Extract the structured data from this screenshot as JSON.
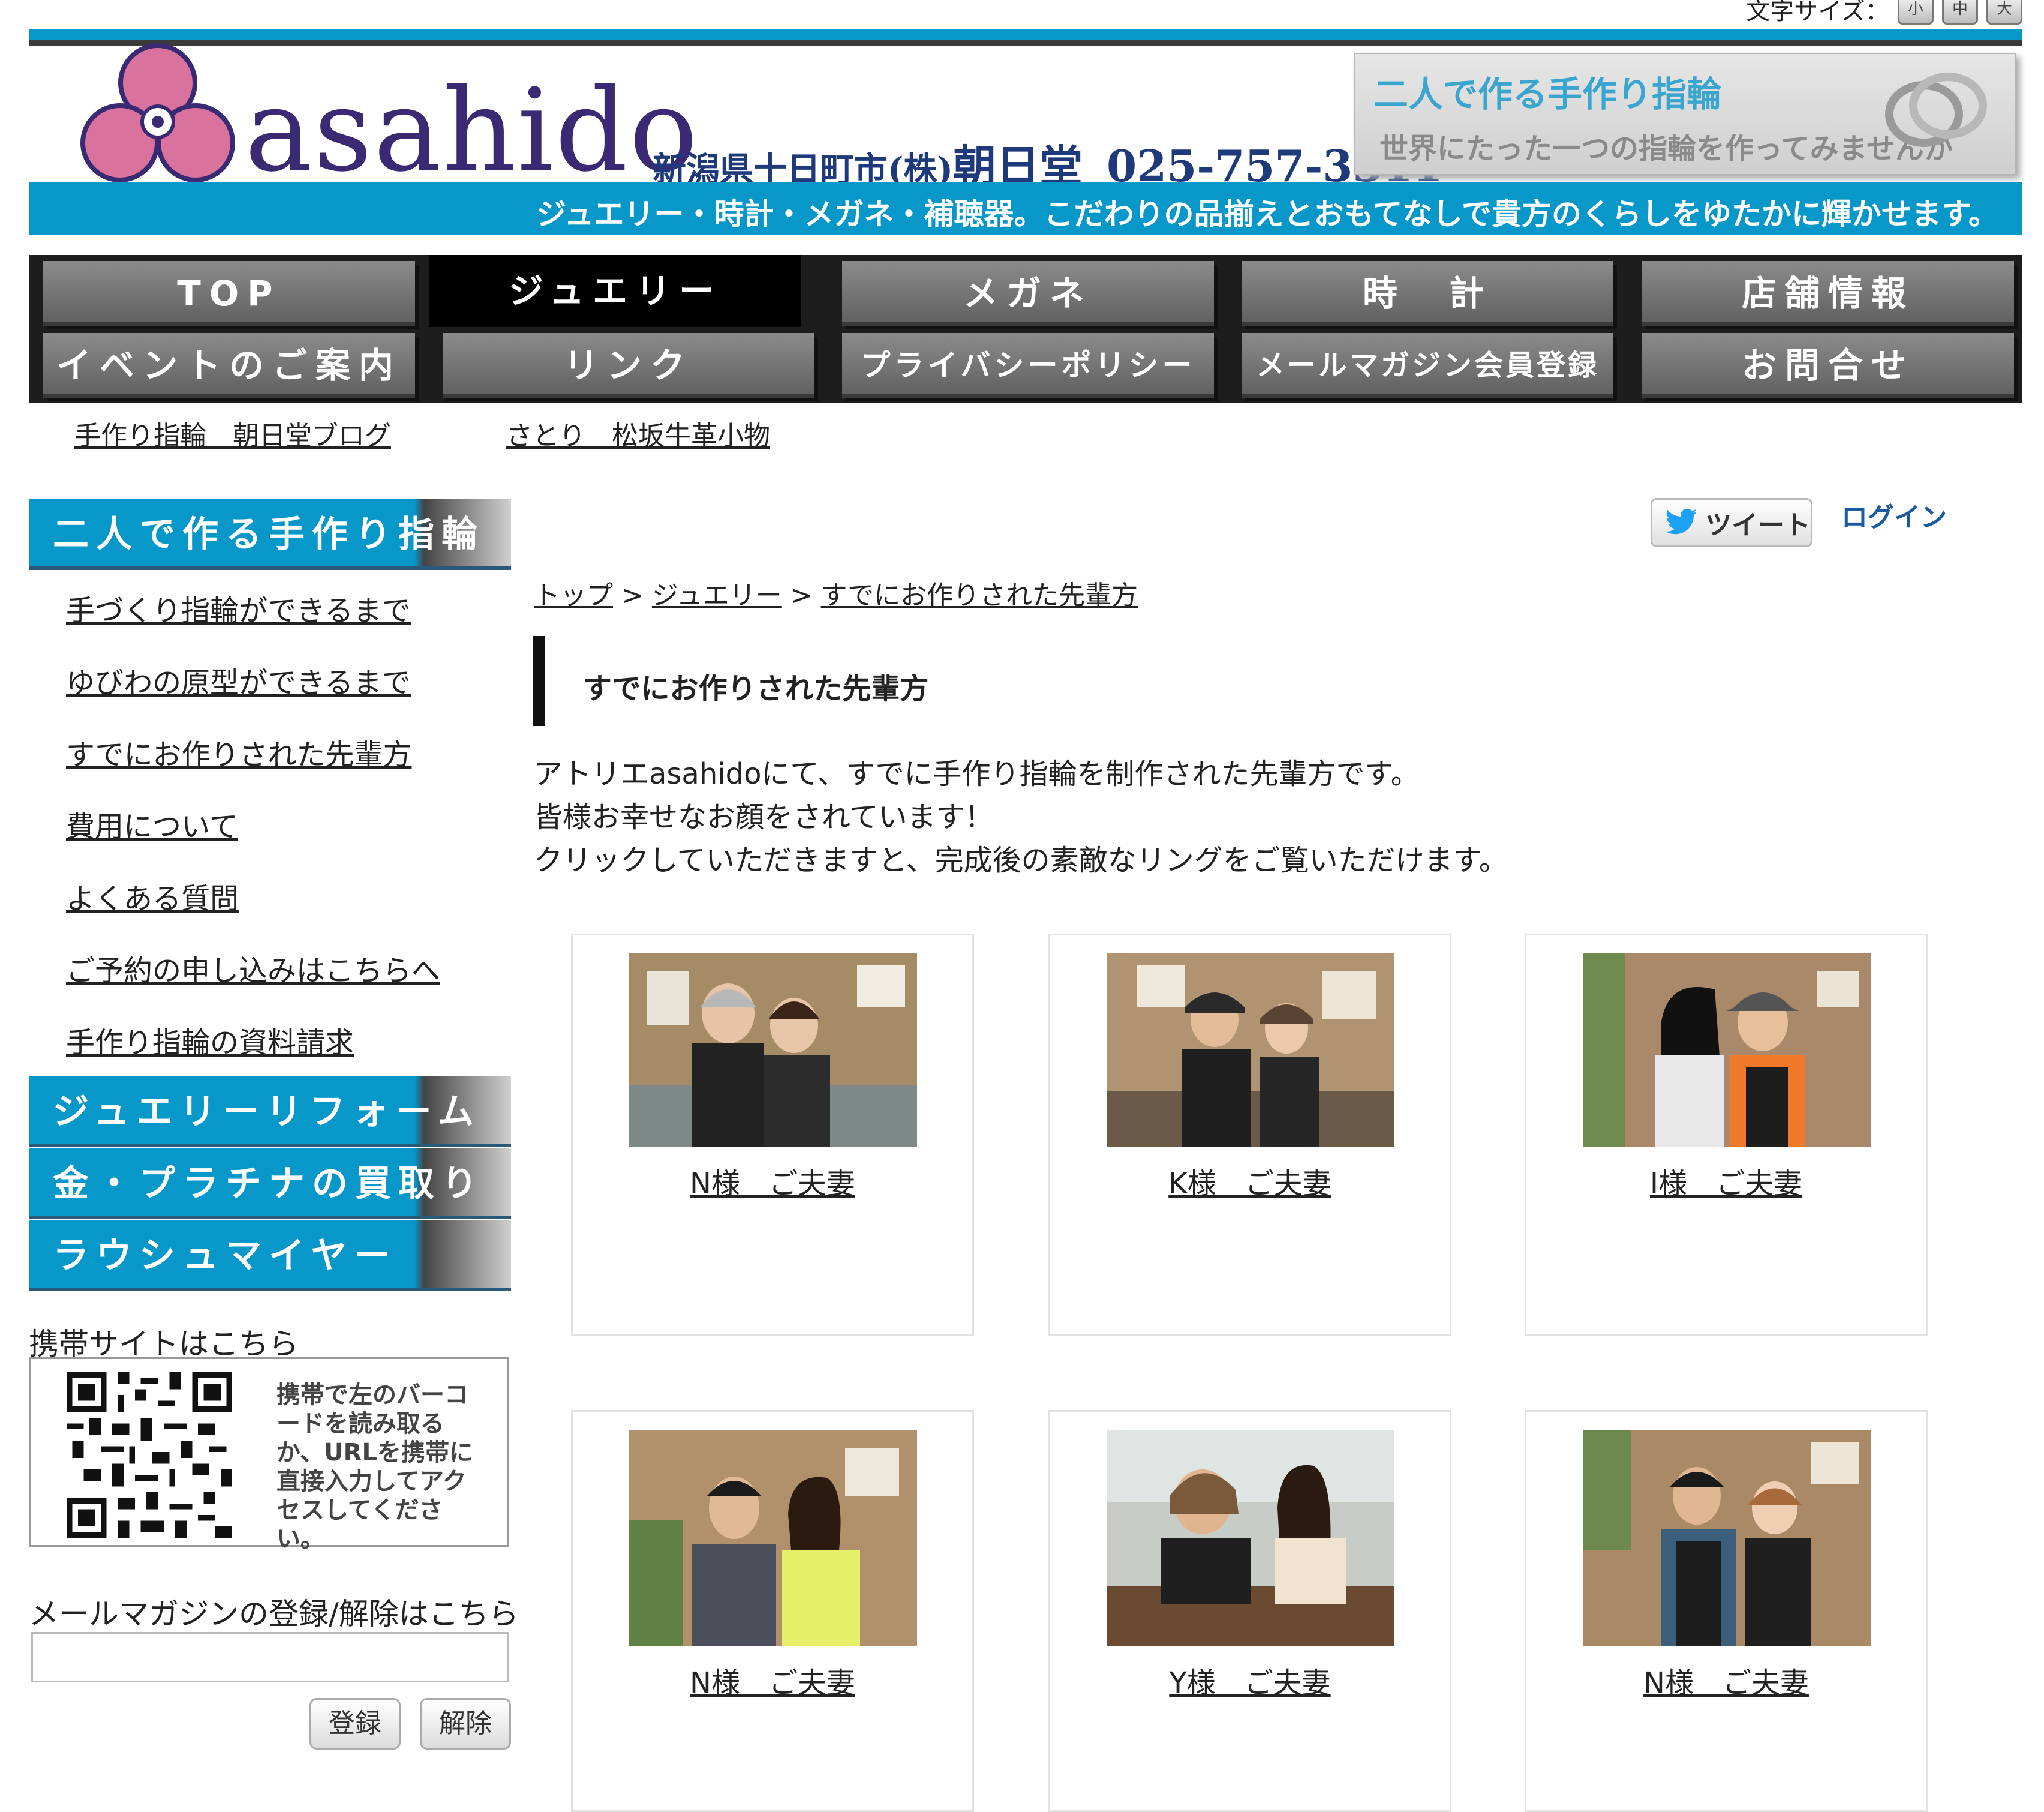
{
  "font_size_widget": {
    "label": "文字サイズ：",
    "buttons": [
      "小",
      "中",
      "大"
    ]
  },
  "header": {
    "logo_text": "asahido",
    "company_prefix": "新潟県十日町市",
    "company_kabu": "(株)",
    "company_name": "朝日堂",
    "phone": "025-757-3311",
    "banner_title": "二人で作る手作り指輪",
    "banner_sub": "世界にたった一つの指輪を作ってみませんか",
    "tagline": "ジュエリー・時計・メガネ・補聴器。こだわりの品揃えとおもてなしで貴方のくらしをゆたかに輝かせます。"
  },
  "nav": {
    "row1": [
      "TOP",
      "ジュエリー",
      "メガネ",
      "時　計",
      "店舗情報"
    ],
    "row2": [
      "イベントのご案内",
      "リンク",
      "プライバシーポリシー",
      "メールマガジン会員登録",
      "お問合せ"
    ],
    "active": "ジュエリー"
  },
  "sublinks": [
    "手作り指輪　朝日堂ブログ",
    "さとり　松坂牛革小物"
  ],
  "sidebar": {
    "section1_title": "二人で作る手作り指輪",
    "links": [
      "手づくり指輪ができるまで",
      "ゆびわの原型ができるまで",
      "すでにお作りされた先輩方",
      "費用について",
      "よくある質問",
      "ご予約の申し込みはこちらへ",
      "手作り指輪の資料請求"
    ],
    "section2_title": "ジュエリーリフォーム",
    "section3_title": "金・プラチナの買取り",
    "section4_title": "ラウシュマイヤー",
    "mobile_label": "携帯サイトはこちら",
    "mobile_text": "携帯で左のバーコードを読み取るか、URLを携帯に直接入力してアクセスしてください。",
    "mail_label": "メールマガジンの登録/解除はこちら",
    "mail_value": "",
    "register_label": "登録",
    "unregister_label": "解除"
  },
  "toolbar": {
    "tweet_label": "ツイート",
    "login_label": "ログイン"
  },
  "breadcrumb": {
    "items": [
      "トップ",
      "ジュエリー",
      "すでにお作りされた先輩方"
    ],
    "separator": ">"
  },
  "page": {
    "title": "すでにお作りされた先輩方",
    "intro": [
      "アトリエasahidoにて、すでに手作り指輪を制作された先輩方です。",
      "皆様お幸せなお顔をされています！",
      "クリックしていただきますと、完成後の素敵なリングをご覧いただけます。"
    ]
  },
  "couples": [
    {
      "name": "N様　ご夫妻"
    },
    {
      "name": "K様　ご夫妻"
    },
    {
      "name": "I様　ご夫妻"
    },
    {
      "name": "N様　ご夫妻"
    },
    {
      "name": "Y様　ご夫妻"
    },
    {
      "name": "N様　ご夫妻"
    }
  ],
  "colors": {
    "brand_blue": "#0797c9",
    "logo_pink": "#d9729c",
    "logo_navy": "#3a2a73",
    "nav_active": "#000000"
  }
}
